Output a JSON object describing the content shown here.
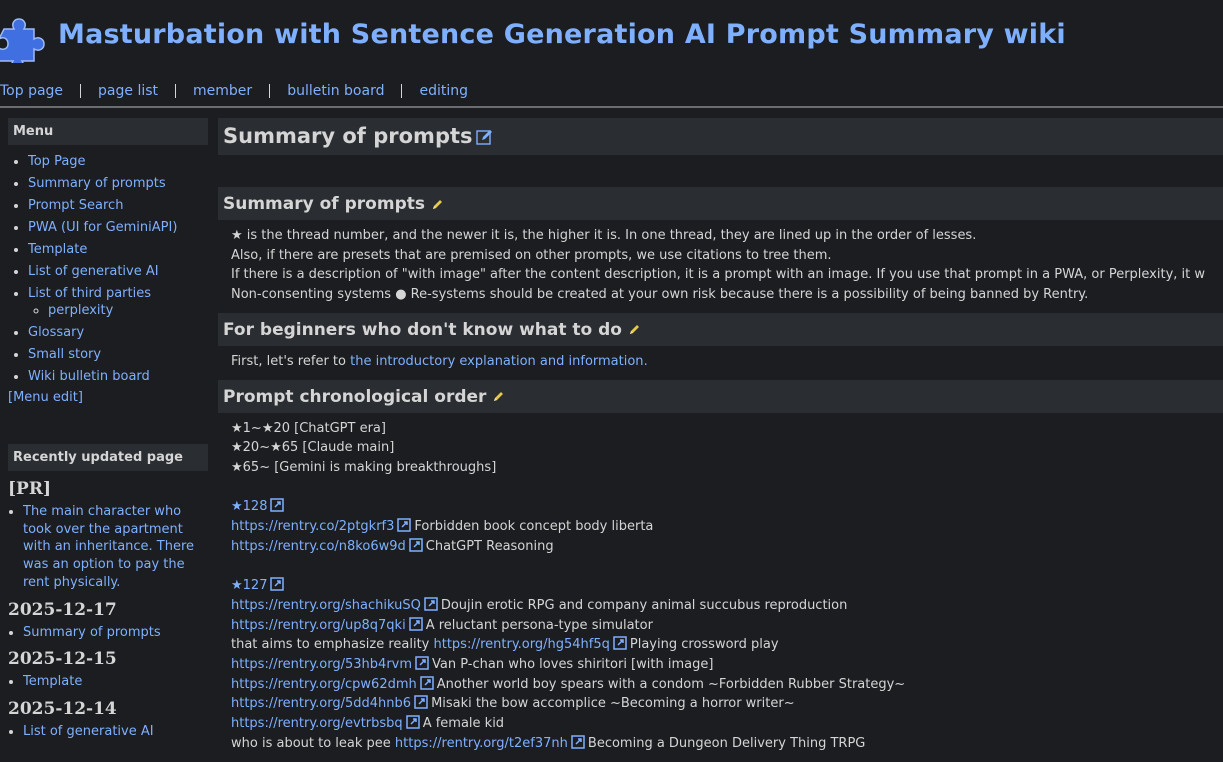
{
  "header": {
    "site_title": "Masturbation with Sentence Generation AI Prompt Summary wiki",
    "nav": [
      "Top page",
      "page list",
      "member",
      "bulletin board",
      "editing"
    ]
  },
  "sidebar": {
    "menu_heading": "Menu",
    "items": [
      "Top Page",
      "Summary of prompts",
      "Prompt Search",
      "PWA (UI for GeminiAPI)",
      "Template",
      "List of generative AI",
      "List of third parties",
      "Glossary",
      "Small story",
      "Wiki bulletin board"
    ],
    "sub_item": "perplexity",
    "menu_edit": "[Menu edit]",
    "recent_heading": "Recently updated page",
    "recent": [
      {
        "date": "[PR]",
        "item": "The main character who took over the apartment with an inheritance. There was an option to pay the rent physically."
      },
      {
        "date": "2025-12-17",
        "item": "Summary of prompts"
      },
      {
        "date": "2025-12-15",
        "item": "Template"
      },
      {
        "date": "2025-12-14",
        "item": "List of generative AI"
      }
    ]
  },
  "main": {
    "page_title": "Summary of prompts",
    "sections": [
      {
        "heading": "Summary of prompts",
        "lines": [
          "★ is the thread number, and the newer it is, the higher it is. In one thread, they are lined up in the order of lesses.",
          "Also, if there are presets that are premised on other prompts, we use citations to tree them.",
          "If there is a description of \"with image\" after the content description, it is a prompt with an image. If you use that prompt in a PWA, or Perplexity, it w",
          "Non-consenting systems ● Re-systems should be created at your own risk because there is a possibility of being banned by Rentry."
        ]
      },
      {
        "heading": "For beginners who don't know what to do",
        "prefix": "First, let's refer to ",
        "link": "the introductory explanation and information",
        "suffix": "."
      },
      {
        "heading": "Prompt chronological order",
        "eras": [
          "★1~★20 [ChatGPT era]",
          "★20~★65 [Claude main]",
          "★65~ [Gemini is making breakthroughs]"
        ],
        "t128": "★128",
        "r128": [
          {
            "url": "https://rentry.co/2ptgkrf3",
            "desc": "Forbidden book concept body liberta"
          },
          {
            "url": "https://rentry.co/n8ko6w9d",
            "desc": "ChatGPT Reasoning"
          }
        ],
        "t127": "★127",
        "r127_1": {
          "url": "https://rentry.org/shachikuSQ",
          "desc": "Doujin erotic RPG and company animal succubus reproduction"
        },
        "r127_2": {
          "url": "https://rentry.org/up8q7qki",
          "desc": "A reluctant persona-type simulator"
        },
        "r127_3": {
          "pre": "that aims to emphasize reality ",
          "url": "https://rentry.org/hg54hf5q",
          "desc": "Playing crossword play"
        },
        "r127_4": {
          "url": "https://rentry.org/53hb4rvm",
          "desc": "Van P-chan who loves shiritori [with image]"
        },
        "r127_5": {
          "url": "https://rentry.org/cpw62dmh",
          "desc": "Another world boy spears with a condom ~Forbidden Rubber Strategy~"
        },
        "r127_6": {
          "url": "https://rentry.org/5dd4hnb6",
          "desc": "Misaki the bow accomplice ~Becoming a horror writer~"
        },
        "r127_7": {
          "url": "https://rentry.org/evtrbsbq",
          "desc": "A female kid"
        },
        "r127_8": {
          "pre": "who is about to leak pee ",
          "url": "https://rentry.org/t2ef37nh",
          "desc": "Becoming a Dungeon Delivery Thing TRPG"
        }
      }
    ]
  },
  "colors": {
    "background": "#1b1d20",
    "link": "#7fb0ff",
    "visited": "#d15cff",
    "heading_bar": "#2a2d31"
  },
  "icons": {
    "logo": "puzzle-piece-icon",
    "edit": "pencil-icon",
    "external": "external-link-icon"
  }
}
